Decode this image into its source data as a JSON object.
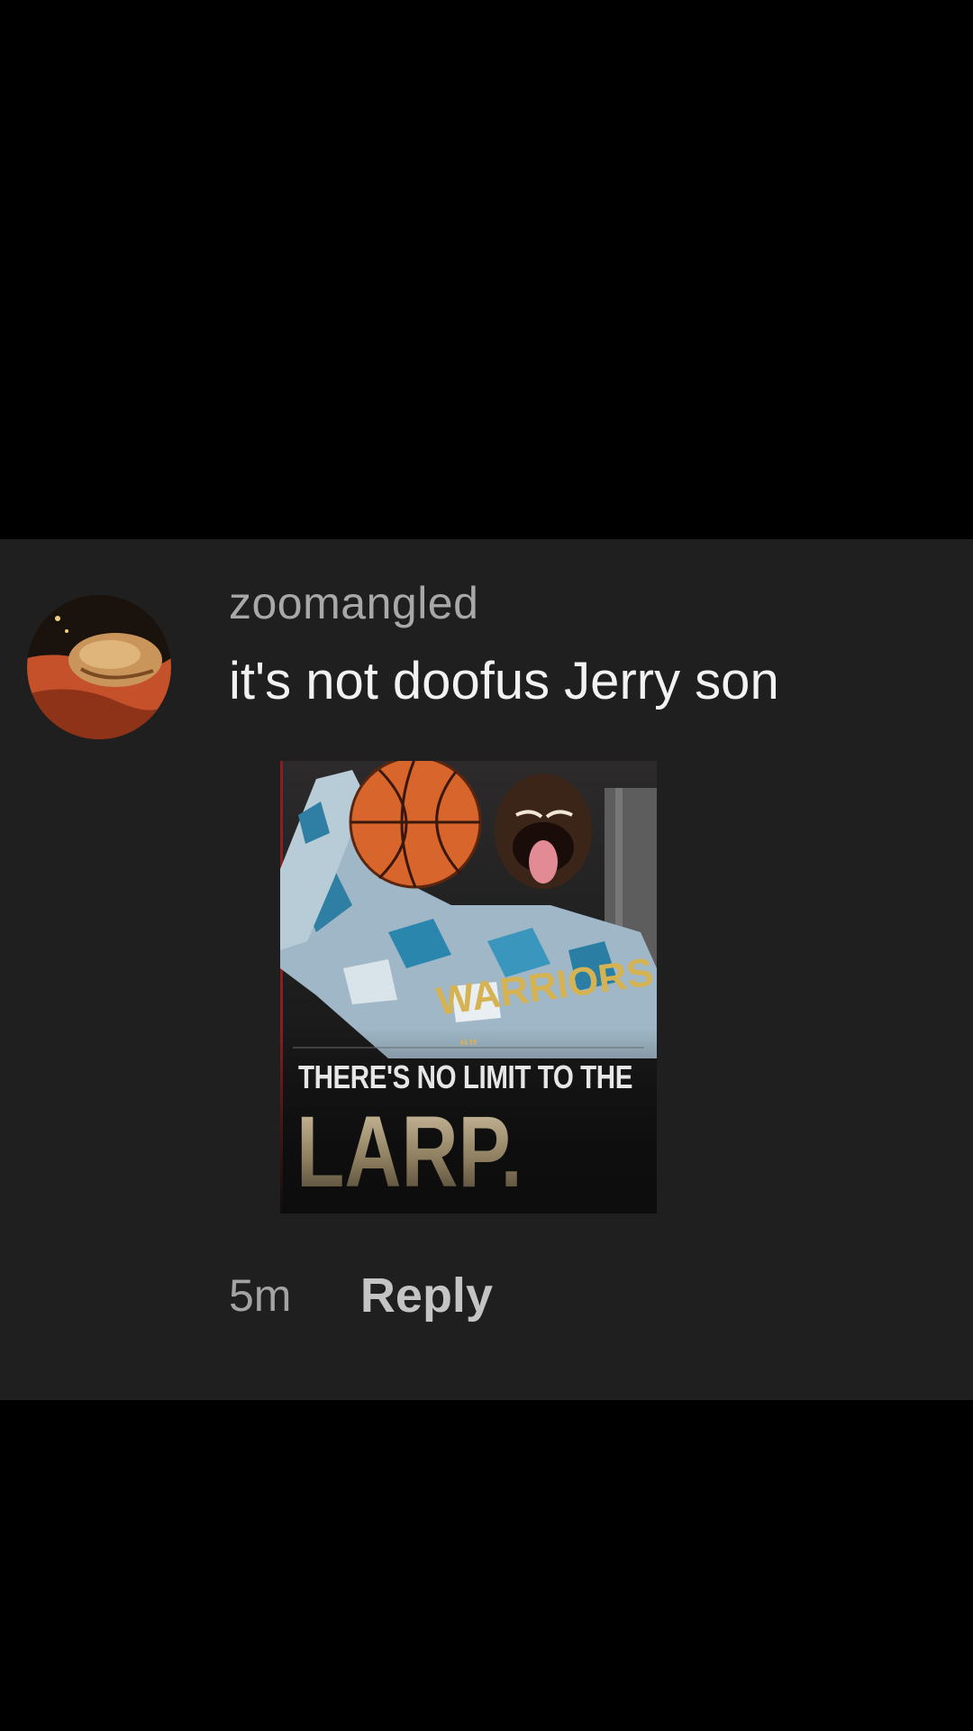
{
  "comment": {
    "username": "zoomangled",
    "text": "it's not doofus Jerry son",
    "timestamp": "5m",
    "reply_label": "Reply",
    "avatar_icon": "avatar-image"
  },
  "meme": {
    "quote_mark": "“”",
    "line1": "THERE'S NO LIMIT TO THE",
    "line2": "LARP.",
    "shirt_text": "WARRIORS"
  },
  "colors": {
    "background": "#000000",
    "card": "#1f1f1f",
    "username": "#a8a8a8",
    "comment_text": "#f2f2f2",
    "reply": "#c4c4c4"
  }
}
